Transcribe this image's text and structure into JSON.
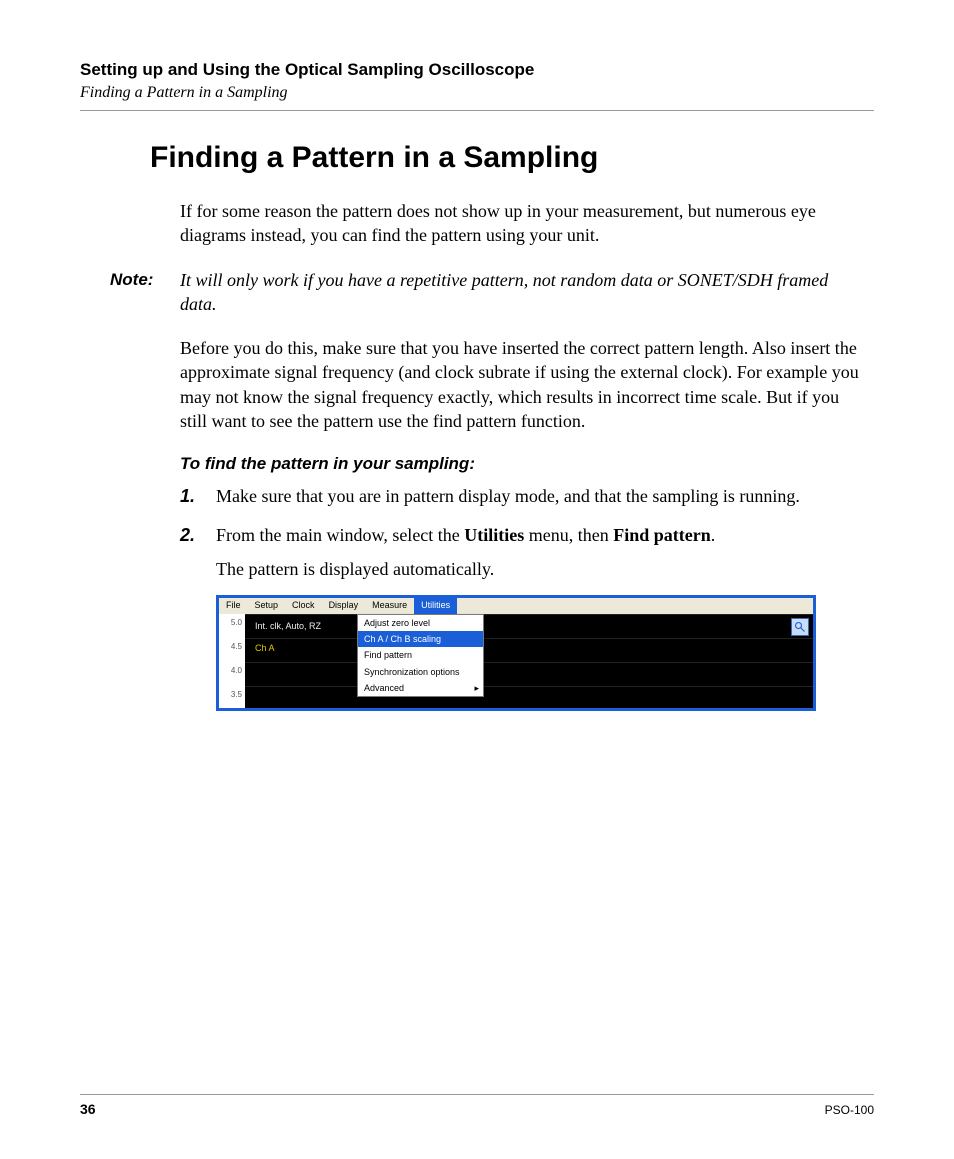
{
  "header": {
    "chapter": "Setting up and Using the Optical Sampling Oscilloscope",
    "section": "Finding a Pattern in a Sampling"
  },
  "title": "Finding a Pattern in a Sampling",
  "paragraphs": {
    "intro": "If for some reason the pattern does not show up in your measurement, but numerous eye diagrams instead, you can find the pattern using your unit.",
    "note_label": "Note:",
    "note_body": "It will only work if you have a repetitive pattern, not random data or SONET/SDH framed data.",
    "before": "Before you do this, make sure that you have inserted the correct pattern length. Also insert the approximate signal frequency (and clock subrate if using the external clock). For example you may not know the signal frequency exactly, which results in incorrect time scale. But if you still want to see the pattern use the find pattern function.",
    "subhead": "To find the pattern in your sampling:",
    "step1": "Make sure that you are in pattern display mode, and that the sampling is running.",
    "step2_pre": "From the main window, select the ",
    "step2_u": "Utilities",
    "step2_mid": " menu, then ",
    "step2_fp": "Find pattern",
    "step2_post": ".",
    "step2_follow": "The pattern is displayed automatically."
  },
  "screenshot": {
    "menubar": [
      "File",
      "Setup",
      "Clock",
      "Display",
      "Measure",
      "Utilities"
    ],
    "open_index": 5,
    "dropdown": {
      "items": [
        "Adjust zero level",
        "Ch A / Ch B scaling",
        "Find pattern",
        "Synchronization options",
        "Advanced"
      ],
      "highlight_index": 1,
      "submenu_index": 4
    },
    "yaxis_ticks": [
      "5.0",
      "4.5",
      "4.0",
      "3.5"
    ],
    "plot_labels": {
      "status": "Int. clk, Auto, RZ",
      "channel": "Ch A"
    }
  },
  "footer": {
    "page": "36",
    "model": "PSO-100"
  }
}
